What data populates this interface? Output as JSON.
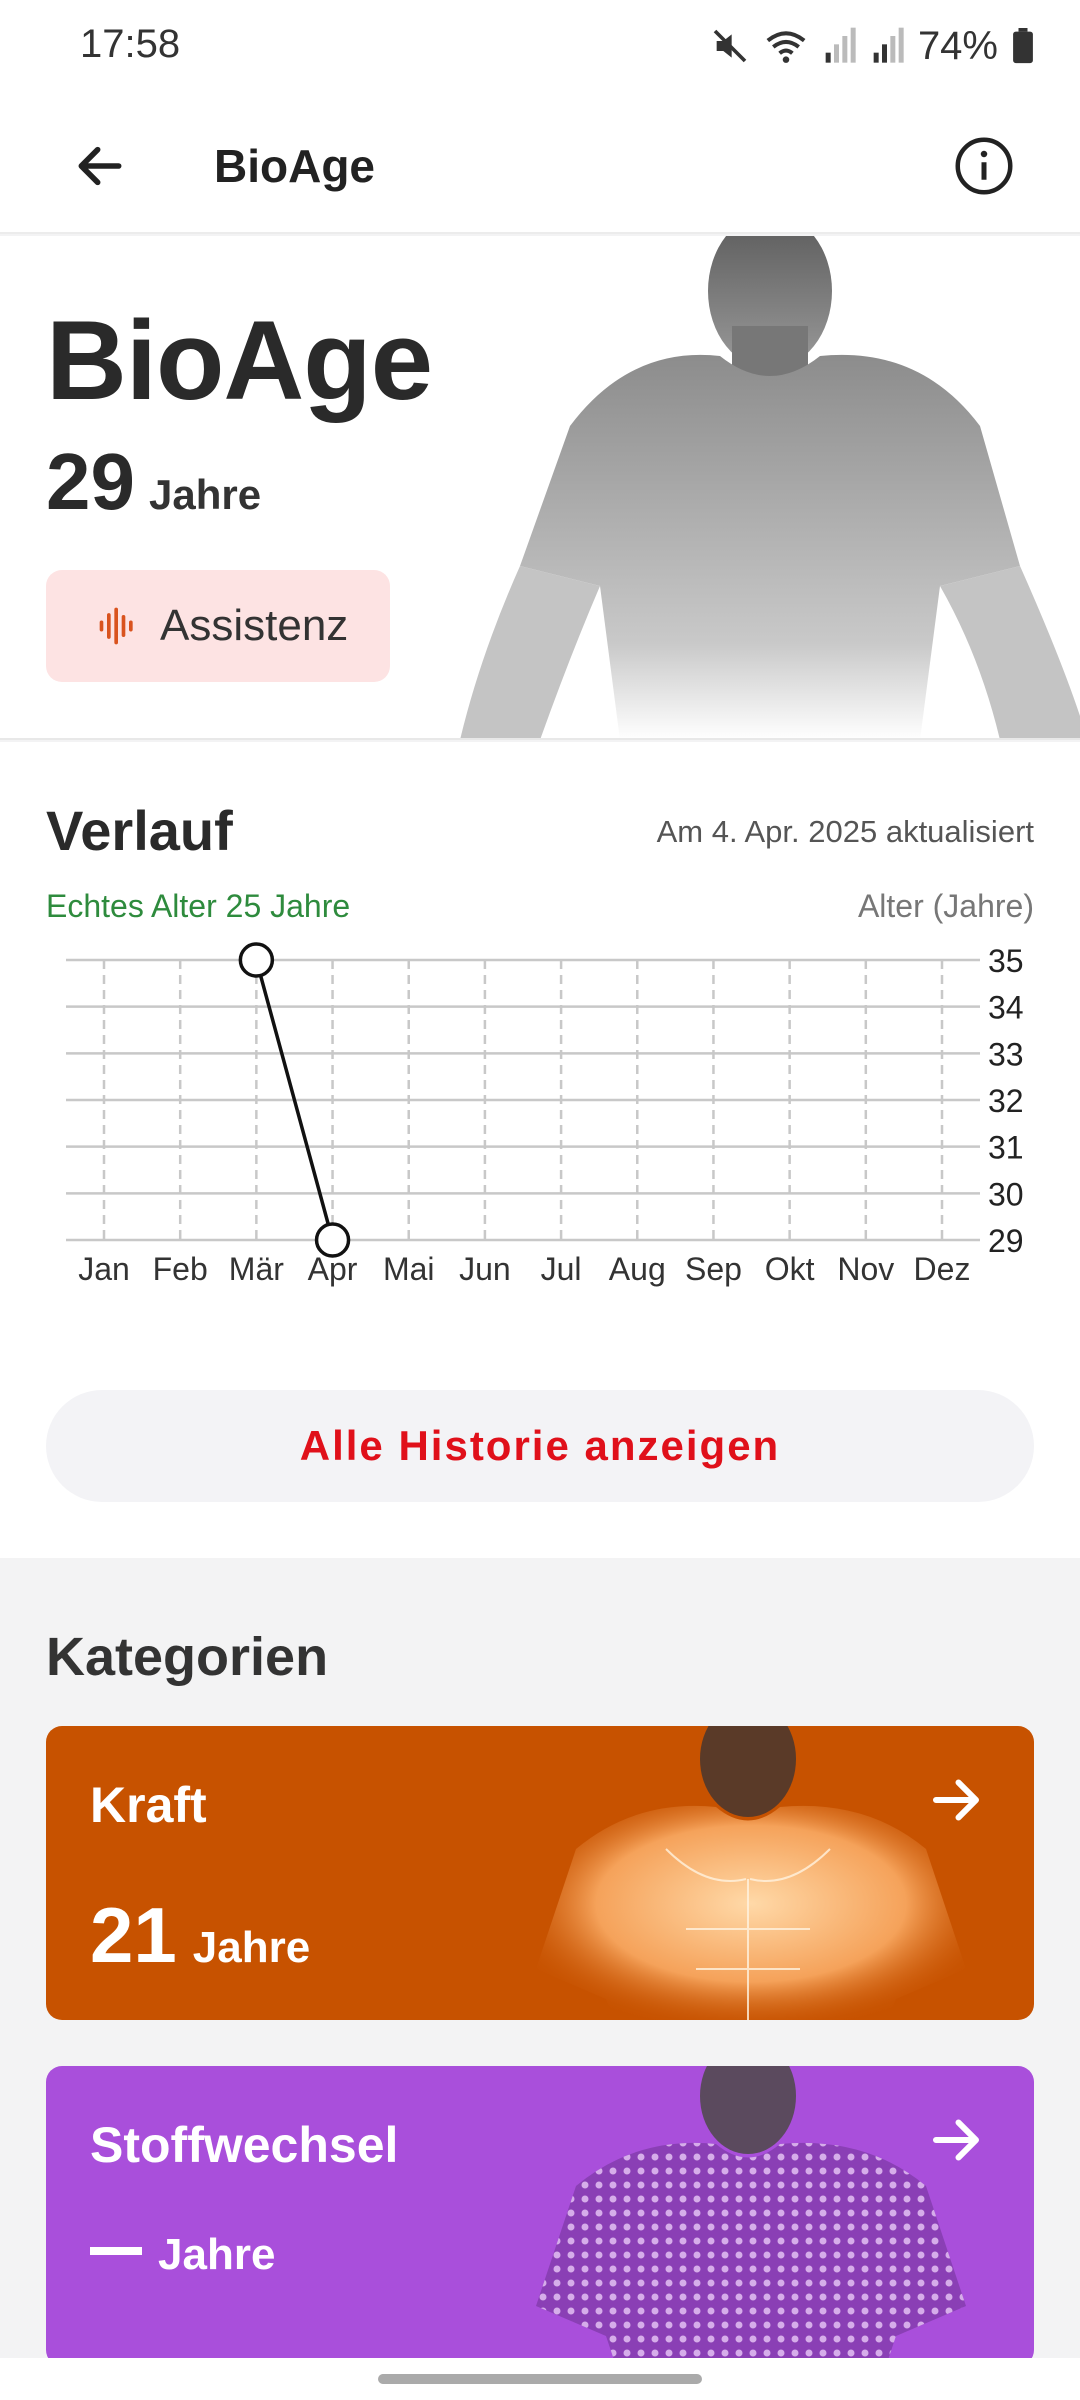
{
  "status": {
    "time": "17:58",
    "battery": "74%"
  },
  "appbar": {
    "title": "BioAge"
  },
  "hero": {
    "title": "BioAge",
    "age_value": "29",
    "age_unit": "Jahre",
    "assist_label": "Assistenz"
  },
  "verlauf": {
    "title": "Verlauf",
    "updated": "Am 4. Apr. 2025 aktualisiert",
    "real_age": "Echtes Alter 25 Jahre",
    "axis_label": "Alter (Jahre)",
    "history_button": "Alle Historie anzeigen"
  },
  "chart_data": {
    "type": "line",
    "categories": [
      "Jan",
      "Feb",
      "Mär",
      "Apr",
      "Mai",
      "Jun",
      "Jul",
      "Aug",
      "Sep",
      "Okt",
      "Nov",
      "Dez"
    ],
    "y_ticks": [
      "35",
      "34",
      "33",
      "32",
      "31",
      "30",
      "29"
    ],
    "ylim": [
      29,
      35
    ],
    "y_axis_side": "right",
    "grid": true,
    "series": [
      {
        "points": [
          {
            "x": "Mär",
            "y": 35
          },
          {
            "x": "Apr",
            "y": 29
          }
        ]
      }
    ]
  },
  "kategorien": {
    "title": "Kategorien",
    "cards": [
      {
        "title": "Kraft",
        "age_value": "21",
        "age_unit": "Jahre",
        "color": "#c75200"
      },
      {
        "title": "Stoffwechsel",
        "age_value": "",
        "age_unit": "Jahre",
        "color": "#a94fdb"
      }
    ]
  }
}
